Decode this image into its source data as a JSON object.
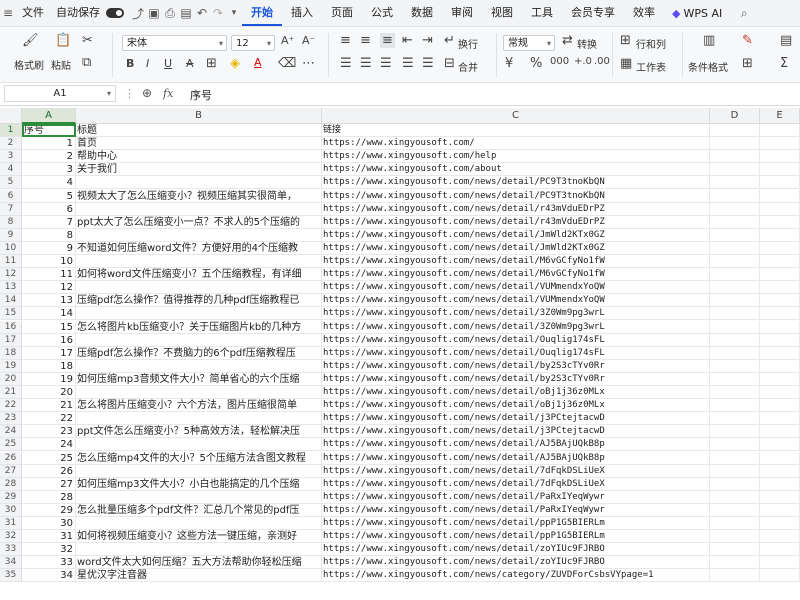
{
  "menubar": {
    "file": "文件",
    "autosave": "自动保存",
    "tabs": [
      "开始",
      "插入",
      "页面",
      "公式",
      "数据",
      "审阅",
      "视图",
      "工具",
      "会员专享",
      "效率"
    ],
    "active_tab": "开始",
    "wps_ai": "WPS AI"
  },
  "ribbon": {
    "format_painter": "格式刷",
    "paste": "粘贴",
    "font_name": "宋体",
    "font_size": "12",
    "wrap": "换行",
    "merge": "合并",
    "number_format": "常规",
    "convert": "转换",
    "row_col": "行和列",
    "worksheet": "工作表",
    "conditional_format": "条件格式"
  },
  "formula_bar": {
    "name_box": "A1",
    "fx": "fx",
    "content": "序号"
  },
  "columns": [
    "A",
    "B",
    "C",
    "D",
    "E"
  ],
  "rows": [
    {
      "n": "1",
      "a": "序号",
      "b": "标题",
      "c": "链接"
    },
    {
      "n": "2",
      "a": "1",
      "b": "首页",
      "c": "https://www.xingyousoft.com/"
    },
    {
      "n": "3",
      "a": "2",
      "b": "帮助中心",
      "c": "https://www.xingyousoft.com/help"
    },
    {
      "n": "4",
      "a": "3",
      "b": "关于我们",
      "c": "https://www.xingyousoft.com/about"
    },
    {
      "n": "5",
      "a": "4",
      "b": "",
      "c": "https://www.xingyousoft.com/news/detail/PC9T3tnoKbQN"
    },
    {
      "n": "6",
      "a": "5",
      "b": "视频太大了怎么压缩变小？视频压缩其实很简单，",
      "c": "https://www.xingyousoft.com/news/detail/PC9T3tnoKbQN"
    },
    {
      "n": "7",
      "a": "6",
      "b": "",
      "c": "https://www.xingyousoft.com/news/detail/r43mVduEDrPZ"
    },
    {
      "n": "8",
      "a": "7",
      "b": "ppt太大了怎么压缩变小一点？不求人的5个压缩的",
      "c": "https://www.xingyousoft.com/news/detail/r43mVduEDrPZ"
    },
    {
      "n": "9",
      "a": "8",
      "b": "",
      "c": "https://www.xingyousoft.com/news/detail/JmWld2KTx0GZ"
    },
    {
      "n": "10",
      "a": "9",
      "b": "不知道如何压缩word文件？方便好用的4个压缩教",
      "c": "https://www.xingyousoft.com/news/detail/JmWld2KTx0GZ"
    },
    {
      "n": "11",
      "a": "10",
      "b": "",
      "c": "https://www.xingyousoft.com/news/detail/M6vGCfyNo1fW"
    },
    {
      "n": "12",
      "a": "11",
      "b": "如何将word文件压缩变小？五个压缩教程，有详细",
      "c": "https://www.xingyousoft.com/news/detail/M6vGCfyNo1fW"
    },
    {
      "n": "13",
      "a": "12",
      "b": "",
      "c": "https://www.xingyousoft.com/news/detail/VUMmendxYoQW"
    },
    {
      "n": "14",
      "a": "13",
      "b": "压缩pdf怎么操作？值得推荐的几种pdf压缩教程已",
      "c": "https://www.xingyousoft.com/news/detail/VUMmendxYoQW"
    },
    {
      "n": "15",
      "a": "14",
      "b": "",
      "c": "https://www.xingyousoft.com/news/detail/3Z0Wm9pg3wrL"
    },
    {
      "n": "16",
      "a": "15",
      "b": "怎么将图片kb压缩变小？关于压缩图片kb的几种方",
      "c": "https://www.xingyousoft.com/news/detail/3Z0Wm9pg3wrL"
    },
    {
      "n": "17",
      "a": "16",
      "b": "",
      "c": "https://www.xingyousoft.com/news/detail/Ouqlig174sFL"
    },
    {
      "n": "18",
      "a": "17",
      "b": "压缩pdf怎么操作？不费脑力的6个pdf压缩教程压",
      "c": "https://www.xingyousoft.com/news/detail/Ouqlig174sFL"
    },
    {
      "n": "19",
      "a": "18",
      "b": "",
      "c": "https://www.xingyousoft.com/news/detail/by2S3cTYv0Rr"
    },
    {
      "n": "20",
      "a": "19",
      "b": "如何压缩mp3音频文件大小？简单省心的六个压缩",
      "c": "https://www.xingyousoft.com/news/detail/by2S3cTYv0Rr"
    },
    {
      "n": "21",
      "a": "20",
      "b": "",
      "c": "https://www.xingyousoft.com/news/detail/oBj1j36z0MLx"
    },
    {
      "n": "22",
      "a": "21",
      "b": "怎么将图片压缩变小？六个方法，图片压缩很简单",
      "c": "https://www.xingyousoft.com/news/detail/oBj1j36z0MLx"
    },
    {
      "n": "23",
      "a": "22",
      "b": "",
      "c": "https://www.xingyousoft.com/news/detail/j3PCtejtacwD"
    },
    {
      "n": "24",
      "a": "23",
      "b": "ppt文件怎么压缩变小？5种高效方法，轻松解决压",
      "c": "https://www.xingyousoft.com/news/detail/j3PCtejtacwD"
    },
    {
      "n": "25",
      "a": "24",
      "b": "",
      "c": "https://www.xingyousoft.com/news/detail/AJ5BAjUQkB8p"
    },
    {
      "n": "26",
      "a": "25",
      "b": "怎么压缩mp4文件的大小？5个压缩方法含图文教程",
      "c": "https://www.xingyousoft.com/news/detail/AJ5BAjUQkB8p"
    },
    {
      "n": "27",
      "a": "26",
      "b": "",
      "c": "https://www.xingyousoft.com/news/detail/7dFqkDSLiUeX"
    },
    {
      "n": "28",
      "a": "27",
      "b": "如何压缩mp3文件大小？小白也能搞定的几个压缩",
      "c": "https://www.xingyousoft.com/news/detail/7dFqkDSLiUeX"
    },
    {
      "n": "29",
      "a": "28",
      "b": "",
      "c": "https://www.xingyousoft.com/news/detail/PaRxIYeqWywr"
    },
    {
      "n": "30",
      "a": "29",
      "b": "怎么批量压缩多个pdf文件？汇总几个常见的pdf压",
      "c": "https://www.xingyousoft.com/news/detail/PaRxIYeqWywr"
    },
    {
      "n": "31",
      "a": "30",
      "b": "",
      "c": "https://www.xingyousoft.com/news/detail/ppP1G5BIERLm"
    },
    {
      "n": "32",
      "a": "31",
      "b": "如何将视频压缩变小？这些方法一键压缩，亲测好",
      "c": "https://www.xingyousoft.com/news/detail/ppP1G5BIERLm"
    },
    {
      "n": "33",
      "a": "32",
      "b": "",
      "c": "https://www.xingyousoft.com/news/detail/zoYIUc9FJRBO"
    },
    {
      "n": "34",
      "a": "33",
      "b": "word文件太大如何压缩？五大方法帮助你轻松压缩",
      "c": "https://www.xingyousoft.com/news/detail/zoYIUc9FJRBO"
    },
    {
      "n": "35",
      "a": "34",
      "b": "星优汉字注音器",
      "c": "https://www.xingyousoft.com/news/category/ZUVDForCsbsVYpage=1"
    }
  ]
}
